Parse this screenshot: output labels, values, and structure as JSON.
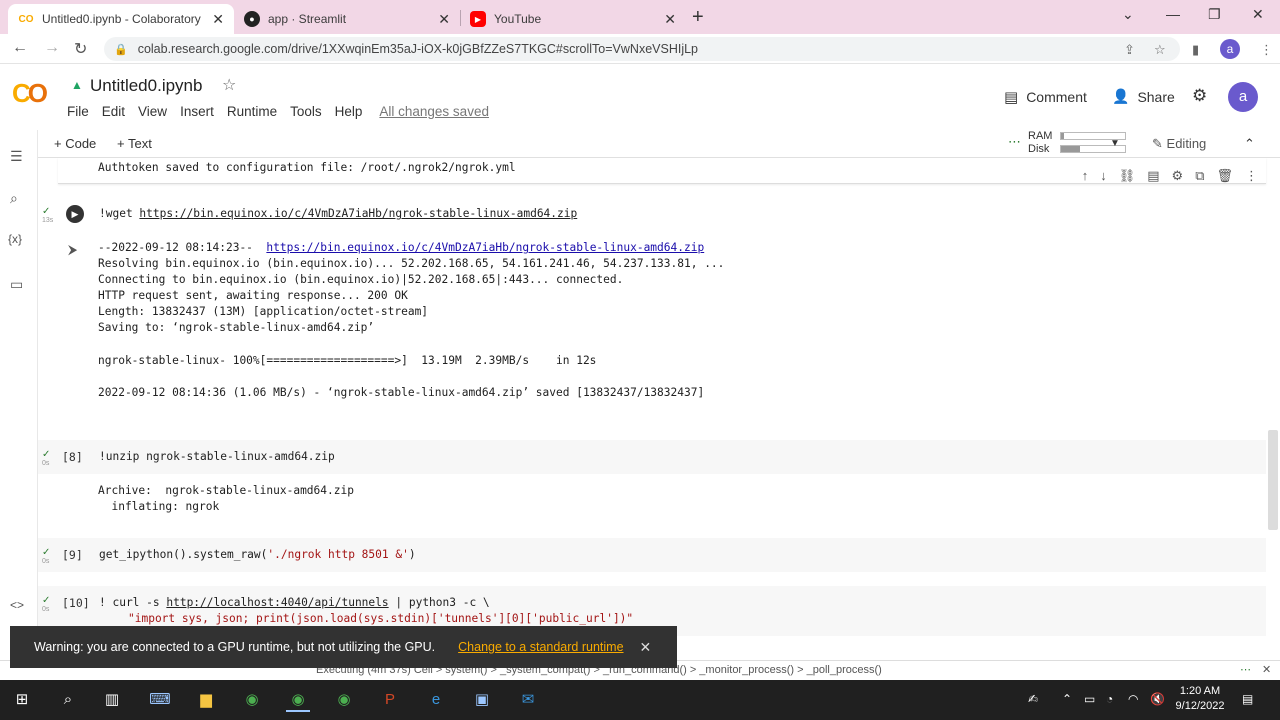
{
  "tabs": [
    {
      "title": "Untitled0.ipynb - Colaboratory",
      "active": true
    },
    {
      "title": "app · Streamlit",
      "active": false
    },
    {
      "title": "YouTube",
      "active": false
    }
  ],
  "address": {
    "url": "colab.research.google.com/drive/1XXwqinEm35aJ-iOX-k0jGBfZZeS7TKGC#scrollTo=VwNxeVSHIjLp"
  },
  "profile_initial": "a",
  "notebook": {
    "title": "Untitled0.ipynb",
    "menu": [
      "File",
      "Edit",
      "View",
      "Insert",
      "Runtime",
      "Tools",
      "Help"
    ],
    "saved_status": "All changes saved",
    "comment_label": "Comment",
    "share_label": "Share"
  },
  "toolbar": {
    "code_label": "+ Code",
    "text_label": "+ Text",
    "ram_label": "RAM",
    "disk_label": "Disk",
    "ram_fraction": 0.05,
    "disk_fraction": 0.3,
    "editing_label": "Editing"
  },
  "cells": {
    "prev_output": "Authtoken saved to configuration file: /root/.ngrok2/ngrok.yml",
    "wget": {
      "cmd_prefix": "!wget ",
      "url": "https://bin.equinox.io/c/4VmDzA7iaHb/ngrok-stable-linux-amd64.zip",
      "exec_time": "13s",
      "out_prefix": "--2022-09-12 08:14:23--  ",
      "out_url": "https://bin.equinox.io/c/4VmDzA7iaHb/ngrok-stable-linux-amd64.zip",
      "lines": [
        "Resolving bin.equinox.io (bin.equinox.io)... 52.202.168.65, 54.161.241.46, 54.237.133.81, ...",
        "Connecting to bin.equinox.io (bin.equinox.io)|52.202.168.65|:443... connected.",
        "HTTP request sent, awaiting response... 200 OK",
        "Length: 13832437 (13M) [application/octet-stream]",
        "Saving to: ‘ngrok-stable-linux-amd64.zip’",
        "",
        "ngrok-stable-linux- 100%[===================>]  13.19M  2.39MB/s    in 12s",
        "",
        "2022-09-12 08:14:36 (1.06 MB/s) - ‘ngrok-stable-linux-amd64.zip’ saved [13832437/13832437]"
      ]
    },
    "unzip": {
      "count": "[8]",
      "exec_time": "0s",
      "cmd": "!unzip ngrok-stable-linux-amd64.zip",
      "lines": [
        "Archive:  ngrok-stable-linux-amd64.zip",
        "  inflating: ngrok"
      ]
    },
    "raw": {
      "count": "[9]",
      "exec_time": "0s",
      "cmd_prefix": "get_ipython().system_raw(",
      "cmd_str": "'./ngrok http 8501 &'",
      "cmd_suffix": ")"
    },
    "curl": {
      "count": "[10]",
      "exec_time": "0s",
      "cmd_prefix": "! curl -s ",
      "url": "http://localhost:4040/api/tunnels",
      "cmd_suffix": " | python3 -c \\",
      "line2": "\"import sys, json; print(json.load(sys.stdin)['tunnels'][0]['public_url'])\""
    }
  },
  "statusbar": {
    "text": "Executing (4m 37s)  Cell > system() > _system_compat() > _run_command() > _monitor_process() > _poll_process()"
  },
  "toast": {
    "message": "Warning: you are connected to a GPU runtime, but not utilizing the GPU.",
    "action": "Change to a standard runtime"
  },
  "clock": {
    "time": "1:20 AM",
    "date": "9/12/2022"
  },
  "colors": {
    "tabstrip": "#f2d7e6",
    "accent": "#f9ab00",
    "link": "#1a0dab",
    "taskbar": "#202020"
  }
}
